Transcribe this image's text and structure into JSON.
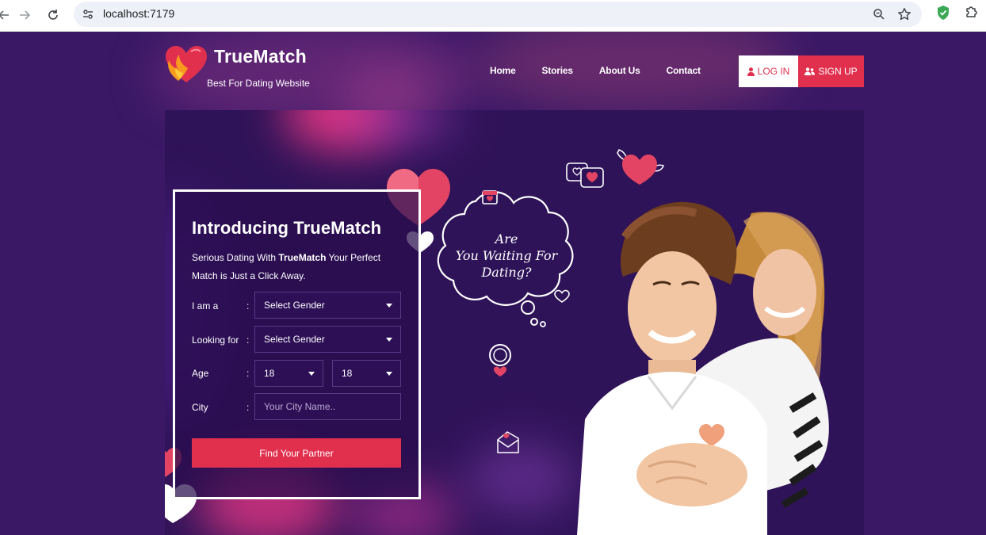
{
  "browser": {
    "url": "localhost:7179",
    "icons": [
      "back-icon",
      "forward-icon",
      "reload-icon",
      "site-info-icon",
      "zoom-icon",
      "bookmark-star-icon",
      "shield-extension-icon",
      "extensions-puzzle-icon"
    ]
  },
  "header": {
    "brand_name": "TrueMatch",
    "tagline": "Best For Dating Website",
    "nav": [
      "Home",
      "Stories",
      "About Us",
      "Contact"
    ],
    "login_label": "LOG IN",
    "signup_label": "SIGN UP"
  },
  "hero": {
    "title": "Introducing TrueMatch",
    "intro_prefix": "Serious Dating With ",
    "intro_brand": "TrueMatch",
    "intro_suffix": " Your Perfect Match is Just a Click Away.",
    "bubble_line1": "Are",
    "bubble_line2": "You Waiting For",
    "bubble_line3": "Dating?"
  },
  "form": {
    "colon": ":",
    "i_am_label": "I am a",
    "i_am_value": "Select Gender",
    "looking_label": "Looking for",
    "looking_value": "Select Gender",
    "age_label": "Age",
    "age_from": "18",
    "age_to": "18",
    "city_label": "City",
    "city_placeholder": "Your City Name..",
    "submit_label": "Find Your Partner"
  },
  "colors": {
    "page_bg": "#3a1866",
    "accent": "#e0304e",
    "white": "#ffffff"
  }
}
